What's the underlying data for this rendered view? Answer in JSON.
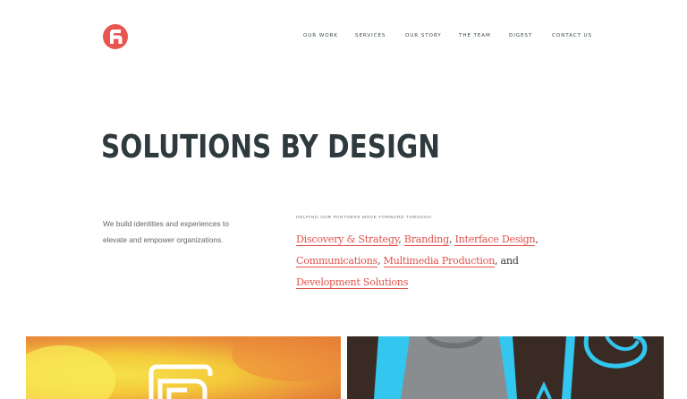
{
  "header": {
    "logo_name": "logo-mark",
    "nav": [
      {
        "label": "OUR WORK"
      },
      {
        "label": "SERVICES"
      },
      {
        "label": "OUR STORY"
      },
      {
        "label": "THE TEAM"
      },
      {
        "label": "DIGEST"
      },
      {
        "label": "CONTACT US"
      }
    ]
  },
  "hero": {
    "title": "SOLUTIONS BY DESIGN"
  },
  "intro": {
    "line1": "We build identities and experiences to",
    "line2": "elevate and empower organizations."
  },
  "services": {
    "label": "HELPING OUR PARTNERS MOVE FORWARD THROUGH",
    "items": [
      "Discovery & Strategy",
      "Branding",
      "Interface Design",
      "Communications",
      "Multimedia Production",
      "Development Solutions"
    ],
    "and_word": "and",
    "comma": ","
  },
  "colors": {
    "accent": "#e1534d",
    "heading": "#2f3a3e",
    "tile_right_bg": "#33c6ef"
  }
}
